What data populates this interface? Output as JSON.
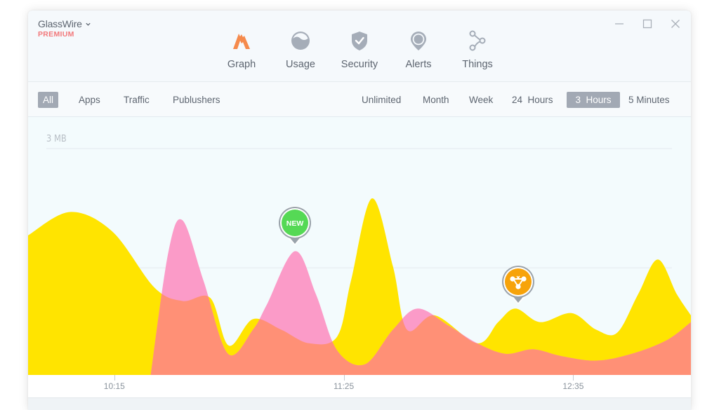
{
  "app": {
    "name": "GlassWire",
    "tier": "PREMIUM",
    "menu_icon": "chevron-down-icon"
  },
  "window_controls": [
    {
      "name": "minimize",
      "icon": "minimize-icon"
    },
    {
      "name": "maximize",
      "icon": "maximize-icon"
    },
    {
      "name": "close",
      "icon": "close-icon"
    }
  ],
  "nav": {
    "active": "Graph",
    "items": [
      {
        "label": "Graph",
        "icon": "graph-mountain-icon"
      },
      {
        "label": "Usage",
        "icon": "usage-gauge-icon"
      },
      {
        "label": "Security",
        "icon": "shield-check-icon"
      },
      {
        "label": "Alerts",
        "icon": "map-pin-icon"
      },
      {
        "label": "Things",
        "icon": "connected-nodes-icon"
      }
    ]
  },
  "filters": {
    "view_tabs": [
      {
        "label": "All",
        "active": true
      },
      {
        "label": "Apps",
        "active": false
      },
      {
        "label": "Traffic",
        "active": false
      },
      {
        "label": "Publushers",
        "active": false
      }
    ],
    "time_ranges": [
      {
        "label": "Unlimited",
        "active": false
      },
      {
        "label": "Month",
        "active": false
      },
      {
        "label": "Week",
        "active": false
      },
      {
        "label": "24  Hours",
        "active": false
      },
      {
        "label": "3  Hours",
        "active": true
      },
      {
        "label": "5 Minutes",
        "active": false
      }
    ]
  },
  "colors": {
    "accent": "#f58a4c",
    "premium": "#f2787a",
    "series_a": "#ffe400",
    "series_b": "#fb9bc8",
    "overlap": "#ff9076",
    "marker_new": "#55d955",
    "marker_device": "#f7a30a",
    "marker_ring": "#9aa3ab"
  },
  "chart_data": {
    "type": "area",
    "title": "",
    "xlabel": "",
    "ylabel": "",
    "y_unit": "MB",
    "ylim": [
      0,
      3
    ],
    "y_gridlines": [
      1.42,
      3
    ],
    "y_tick_labels": [
      {
        "value": 3,
        "label": "3 MB"
      }
    ],
    "x_unit": "minutes since 10:15",
    "xlim": [
      -26.3,
      175.9
    ],
    "x_ticks": [
      {
        "value": 0,
        "label": "10:15"
      },
      {
        "value": 70,
        "label": "11:25"
      },
      {
        "value": 140,
        "label": "12:35"
      }
    ],
    "grid": true,
    "legend": "none",
    "series": [
      {
        "name": "traffic-a",
        "color": "#ffe400",
        "points": [
          [
            -26.3,
            1.85
          ],
          [
            -13.5,
            2.16
          ],
          [
            -0.6,
            1.9
          ],
          [
            12.2,
            1.16
          ],
          [
            20.8,
            0.98
          ],
          [
            29.3,
            1.02
          ],
          [
            34.9,
            0.39
          ],
          [
            42.3,
            0.74
          ],
          [
            50.9,
            0.6
          ],
          [
            59.4,
            0.42
          ],
          [
            68.0,
            0.51
          ],
          [
            72.2,
            1.25
          ],
          [
            78.6,
            2.34
          ],
          [
            85.0,
            1.44
          ],
          [
            89.3,
            0.6
          ],
          [
            97.8,
            0.79
          ],
          [
            110.7,
            0.42
          ],
          [
            117.1,
            0.7
          ],
          [
            122.4,
            0.88
          ],
          [
            129.9,
            0.7
          ],
          [
            139.5,
            0.82
          ],
          [
            147.0,
            0.6
          ],
          [
            153.4,
            0.56
          ],
          [
            159.8,
            1.07
          ],
          [
            165.8,
            1.53
          ],
          [
            171.6,
            1.07
          ],
          [
            175.9,
            0.79
          ]
        ]
      },
      {
        "name": "traffic-b",
        "color": "#fb9bc8",
        "points": [
          [
            11.1,
            0.0
          ],
          [
            16.5,
            1.63
          ],
          [
            20.8,
            2.05
          ],
          [
            27.2,
            1.25
          ],
          [
            34.7,
            0.28
          ],
          [
            42.3,
            0.6
          ],
          [
            46.5,
            0.93
          ],
          [
            55.1,
            1.64
          ],
          [
            61.5,
            1.07
          ],
          [
            67.9,
            0.33
          ],
          [
            76.4,
            0.14
          ],
          [
            85.0,
            0.6
          ],
          [
            92.5,
            0.88
          ],
          [
            102.1,
            0.65
          ],
          [
            110.7,
            0.42
          ],
          [
            119.3,
            0.28
          ],
          [
            127.8,
            0.34
          ],
          [
            136.4,
            0.25
          ],
          [
            147.1,
            0.19
          ],
          [
            157.8,
            0.28
          ],
          [
            168.5,
            0.46
          ],
          [
            175.9,
            0.7
          ]
        ]
      }
    ],
    "annotations": [
      {
        "type": "marker",
        "label": "NEW",
        "icon": "new-badge",
        "x": 55.1,
        "series": "traffic-b"
      },
      {
        "type": "marker",
        "label": "",
        "icon": "device-network-icon",
        "x": 123.2,
        "series": "traffic-a"
      }
    ]
  }
}
